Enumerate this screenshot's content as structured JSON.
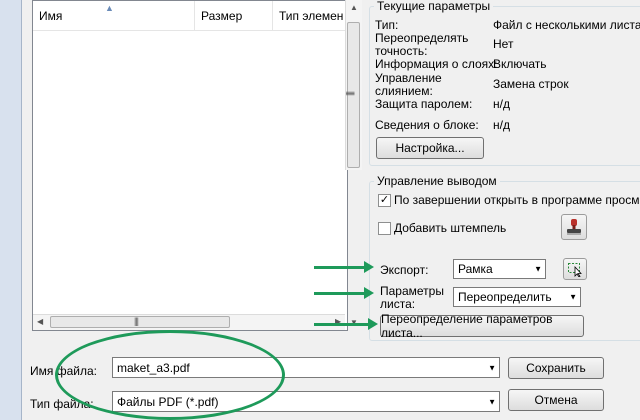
{
  "file_list": {
    "columns": [
      "Имя",
      "Размер",
      "Тип элемен"
    ]
  },
  "current_settings": {
    "title": "Текущие параметры",
    "rows": [
      {
        "label": "Тип:",
        "value": "Файл с несколькими листам"
      },
      {
        "label": "Переопределять точность:",
        "value": "Нет"
      },
      {
        "label": "Информация о слоях:",
        "value": "Включать"
      },
      {
        "label": "Управление слиянием:",
        "value": "Замена строк"
      },
      {
        "label": "Защита паролем:",
        "value": "н/д"
      },
      {
        "label": "Сведения о блоке:",
        "value": "н/д"
      }
    ],
    "settings_button": "Настройка..."
  },
  "output_control": {
    "title": "Управление выводом",
    "open_after": {
      "label": "По завершении открыть в программе просмотра",
      "checked": true
    },
    "add_stamp": {
      "label": "Добавить штемпель",
      "checked": false
    },
    "export_label": "Экспорт:",
    "export_value": "Рамка",
    "sheet_params_label": "Параметры листа:",
    "sheet_params_value": "Переопределить",
    "override_button": "Переопределение параметров листа..."
  },
  "bottom": {
    "filename_label": "Имя файла:",
    "filename_value": "maket_a3.pdf",
    "filetype_label": "Тип файла:",
    "filetype_value": "Файлы PDF (*.pdf)",
    "save_button": "Сохранить",
    "cancel_button": "Отмена"
  },
  "colors": {
    "annotation_green": "#1e9a5a"
  }
}
